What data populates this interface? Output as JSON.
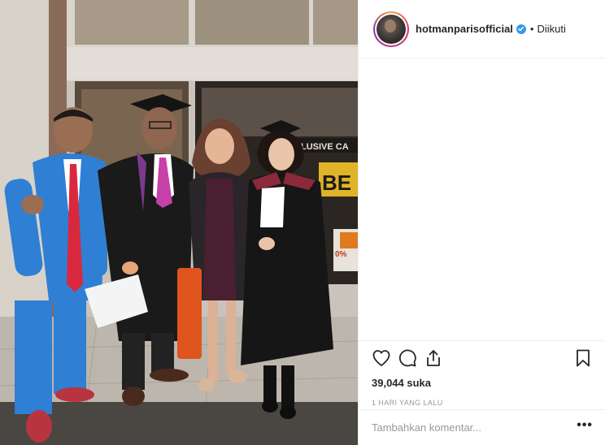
{
  "post": {
    "username": "hotmanparisofficial",
    "verified": true,
    "dot": "•",
    "follow_status": "Diikuti",
    "likes": "39,044 suka",
    "timestamp": "1 HARI YANG LALU",
    "comment_placeholder": "Tambahkan komentar...",
    "more_label": "•••"
  },
  "photo": {
    "storefront_sign": "LUSIVE CA",
    "storefront_banner": "BE",
    "storefront_percent": "0%"
  },
  "icons": {
    "like": "heart-icon",
    "comment": "comment-icon",
    "share": "share-icon",
    "save": "bookmark-icon",
    "verified": "verified-badge-icon"
  },
  "colors": {
    "verified_blue": "#3897f0",
    "text": "#262626",
    "muted": "#999999",
    "divider": "#efefef"
  }
}
